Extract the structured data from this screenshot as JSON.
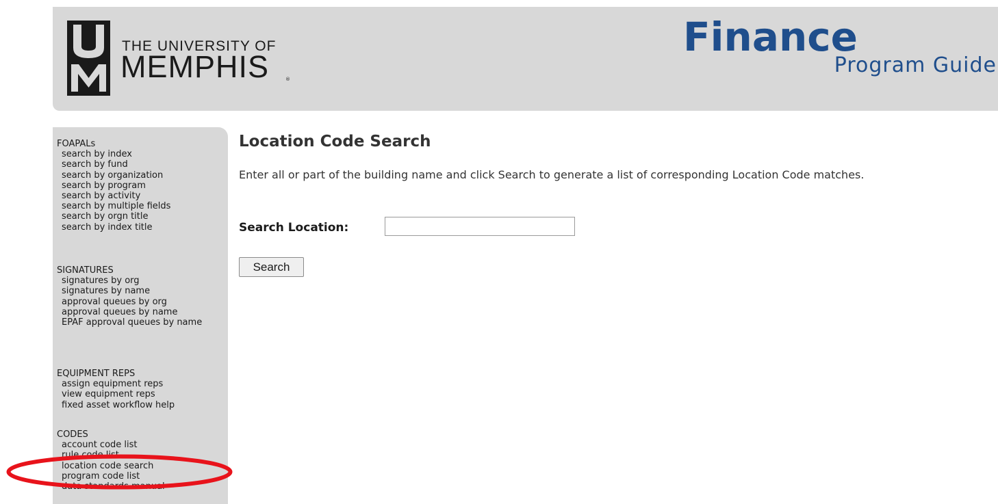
{
  "header": {
    "logo_line1": "THE UNIVERSITY OF",
    "logo_line2": "MEMPHIS",
    "logo_reg": "®",
    "title": "Finance",
    "subtitle": "Program Guide",
    "accent_color": "#1f4e8c",
    "banner_color": "#d8d8d8"
  },
  "sidebar": {
    "groups": [
      {
        "heading": "FOAPALs",
        "items": [
          "search by index",
          "search by fund",
          "search by organization",
          "search by program",
          "search by activity",
          "search by multiple fields",
          "search by orgn title",
          "search by index title"
        ]
      },
      {
        "heading": "SIGNATURES",
        "items": [
          "signatures by org",
          "signatures by name",
          "approval queues by org",
          "approval queues by name",
          "EPAF approval queues by name"
        ]
      },
      {
        "heading": "EQUIPMENT REPS",
        "items": [
          "assign equipment reps",
          "view equipment reps",
          "fixed asset workflow help"
        ]
      },
      {
        "heading": "CODES",
        "items": [
          "account code list",
          "rule code list",
          "location code search",
          "program code list",
          "data standards manual"
        ]
      }
    ]
  },
  "main": {
    "title": "Location Code Search",
    "intro": "Enter all or part of the building name and click Search to generate a list of corresponding Location Code matches.",
    "search_label": "Search Location:",
    "search_value": "",
    "search_button": "Search"
  },
  "annotation": {
    "highlight_color": "#e8131b",
    "highlighted_item": "location code search"
  }
}
